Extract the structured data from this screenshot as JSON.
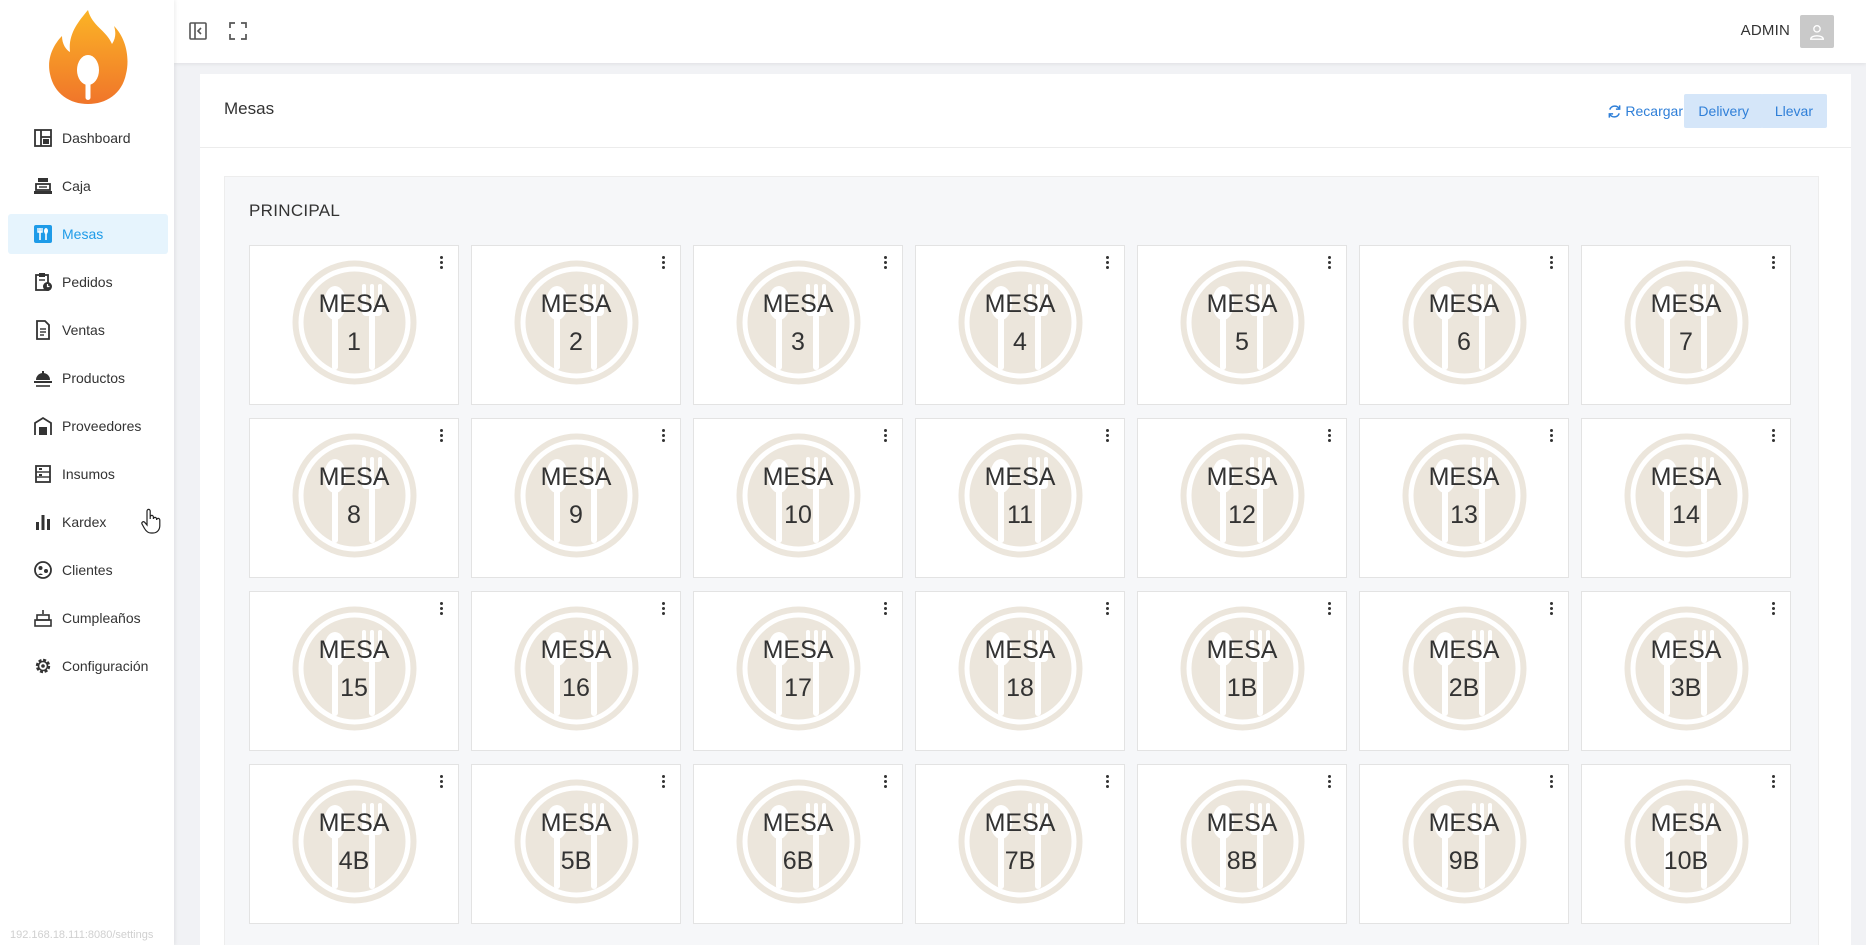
{
  "sidebar": {
    "items": [
      {
        "label": "Dashboard",
        "icon": "dashboard-icon",
        "active": false
      },
      {
        "label": "Caja",
        "icon": "cash-register-icon",
        "active": false
      },
      {
        "label": "Mesas",
        "icon": "dining-table-icon",
        "active": true
      },
      {
        "label": "Pedidos",
        "icon": "clipboard-clock-icon",
        "active": false
      },
      {
        "label": "Ventas",
        "icon": "document-icon",
        "active": false
      },
      {
        "label": "Productos",
        "icon": "food-tray-icon",
        "active": false
      },
      {
        "label": "Proveedores",
        "icon": "warehouse-icon",
        "active": false
      },
      {
        "label": "Insumos",
        "icon": "inventory-icon",
        "active": false
      },
      {
        "label": "Kardex",
        "icon": "bar-chart-icon",
        "active": false
      },
      {
        "label": "Clientes",
        "icon": "customers-icon",
        "active": false
      },
      {
        "label": "Cumpleaños",
        "icon": "cake-icon",
        "active": false
      },
      {
        "label": "Configuración",
        "icon": "gear-icon",
        "active": false
      }
    ],
    "status_url": "192.168.18.111:8080/settings"
  },
  "topbar": {
    "user_name": "ADMIN"
  },
  "page": {
    "title": "Mesas",
    "reload_label": "Recargar",
    "delivery_label": "Delivery",
    "takeaway_label": "Llevar",
    "section_title": "PRINCIPAL"
  },
  "tables": [
    "MESA 1",
    "MESA 2",
    "MESA 3",
    "MESA 4",
    "MESA 5",
    "MESA 6",
    "MESA 7",
    "MESA 8",
    "MESA 9",
    "MESA 10",
    "MESA 11",
    "MESA 12",
    "MESA 13",
    "MESA 14",
    "MESA 15",
    "MESA 16",
    "MESA 17",
    "MESA 18",
    "MESA 1B",
    "MESA 2B",
    "MESA 3B",
    "MESA 4B",
    "MESA 5B",
    "MESA 6B",
    "MESA 7B",
    "MESA 8B",
    "MESA 9B",
    "MESA 10B"
  ],
  "colors": {
    "accent": "#1e9be8",
    "button_bg": "#d5e6f9",
    "button_text": "#2f7fd8",
    "plate": "#ece6dc"
  }
}
